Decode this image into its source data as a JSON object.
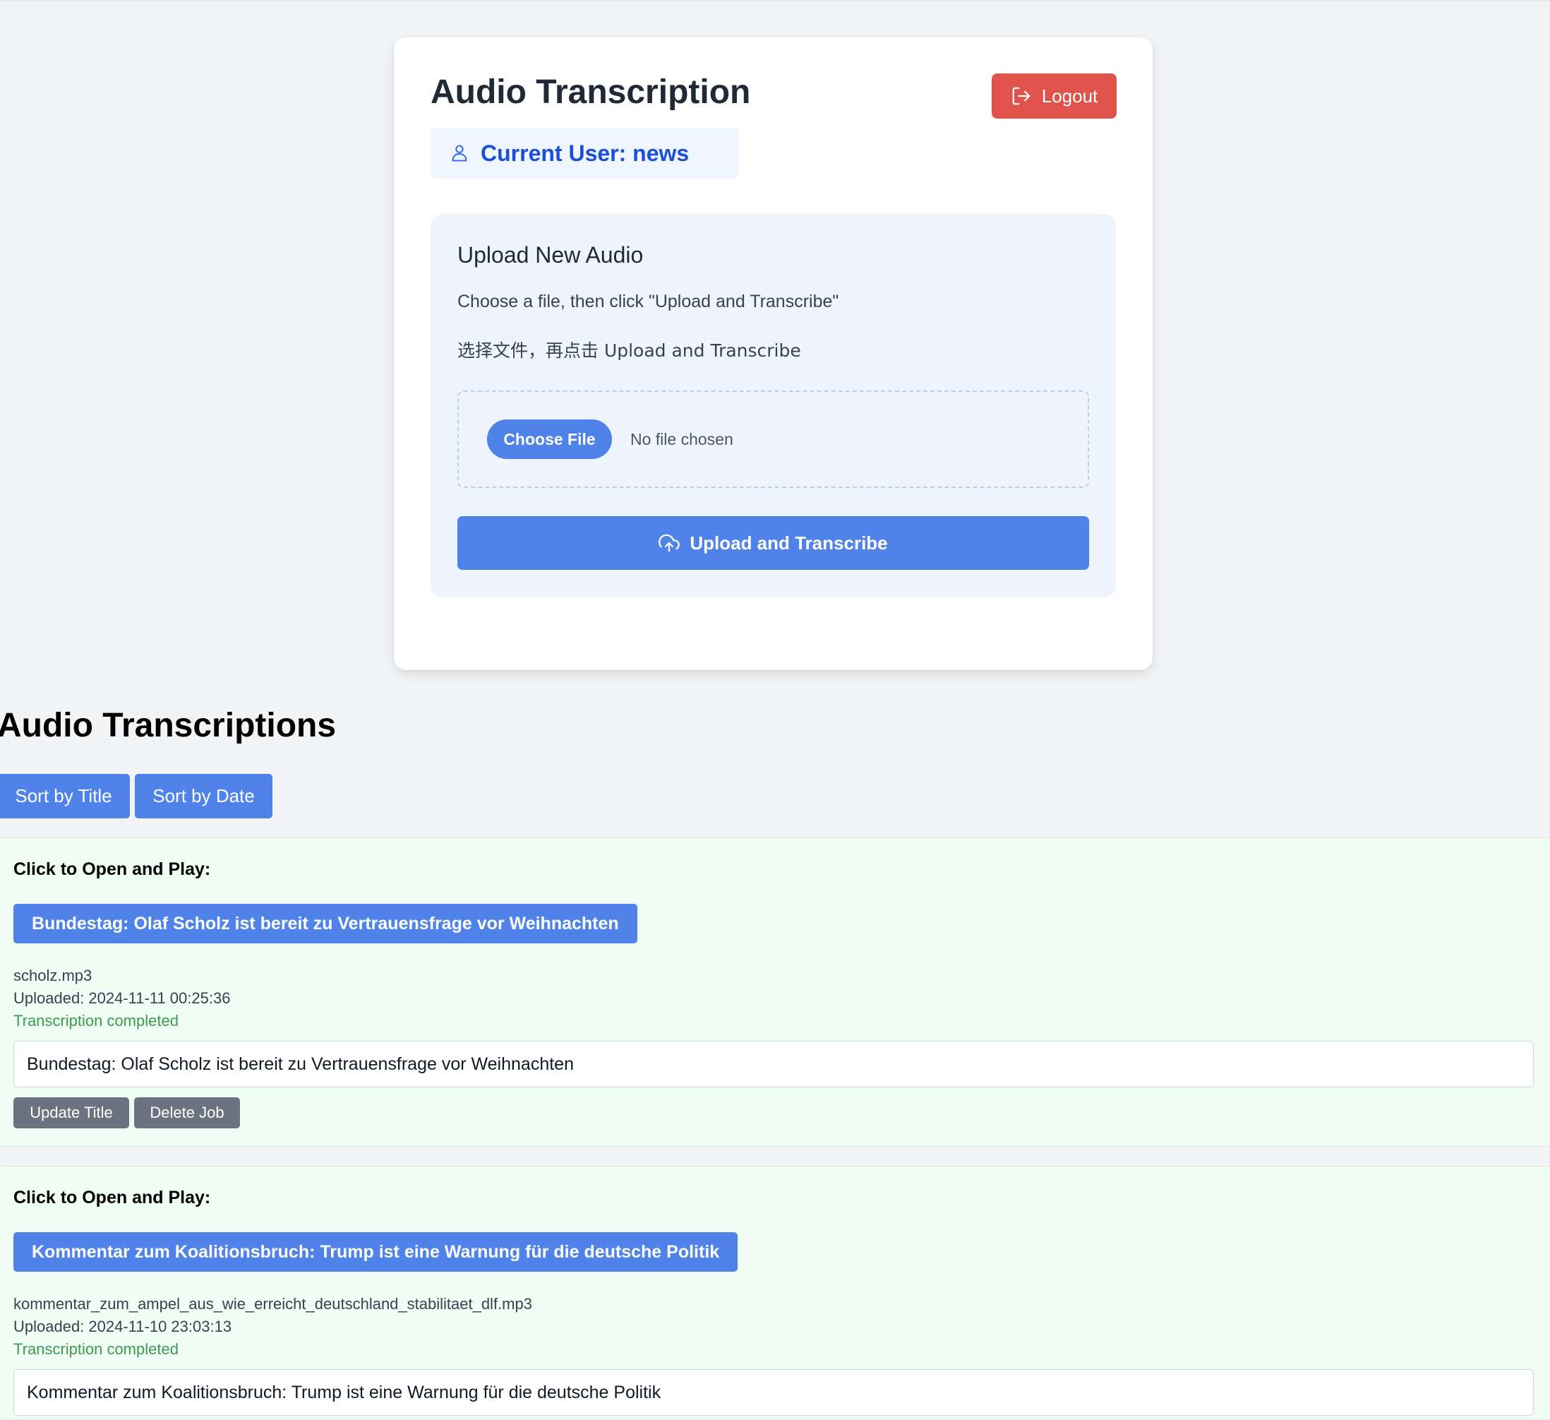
{
  "header": {
    "title": "Audio Transcription",
    "logout_label": "Logout",
    "current_user_label": "Current User: news"
  },
  "upload": {
    "title": "Upload New Audio",
    "instruction_en": "Choose a file, then click \"Upload and Transcribe\"",
    "instruction_zh": "选择文件，再点击 Upload and Transcribe",
    "choose_file_label": "Choose File",
    "file_status": "No file chosen",
    "submit_label": "Upload and Transcribe"
  },
  "transcriptions": {
    "title": "Audio Transcriptions",
    "sort_title_label": "Sort by Title",
    "sort_date_label": "Sort by Date",
    "jobs": [
      {
        "open_label": "Click to Open and Play:",
        "title": "Bundestag: Olaf Scholz ist bereit zu Vertrauensfrage vor Weihnachten",
        "filename": "scholz.mp3",
        "uploaded": "Uploaded: 2024-11-11 00:25:36",
        "status": "Transcription completed",
        "title_value": "Bundestag: Olaf Scholz ist bereit zu Vertrauensfrage vor Weihnachten",
        "update_label": "Update Title",
        "delete_label": "Delete Job"
      },
      {
        "open_label": "Click to Open and Play:",
        "title": "Kommentar zum Koalitionsbruch: Trump ist eine Warnung für die deutsche Politik",
        "filename": "kommentar_zum_ampel_aus_wie_erreicht_deutschland_stabilitaet_dlf.mp3",
        "uploaded": "Uploaded: 2024-11-10 23:03:13",
        "status": "Transcription completed",
        "title_value": "Kommentar zum Koalitionsbruch: Trump ist eine Warnung für die deutsche Politik"
      }
    ]
  },
  "colors": {
    "primary": "#4f83ea",
    "danger": "#e0534c",
    "secondary": "#6b7280",
    "success_text": "#3b9c4e",
    "job_background": "#f0fdf4",
    "user_badge_text": "#1d4ed8"
  }
}
